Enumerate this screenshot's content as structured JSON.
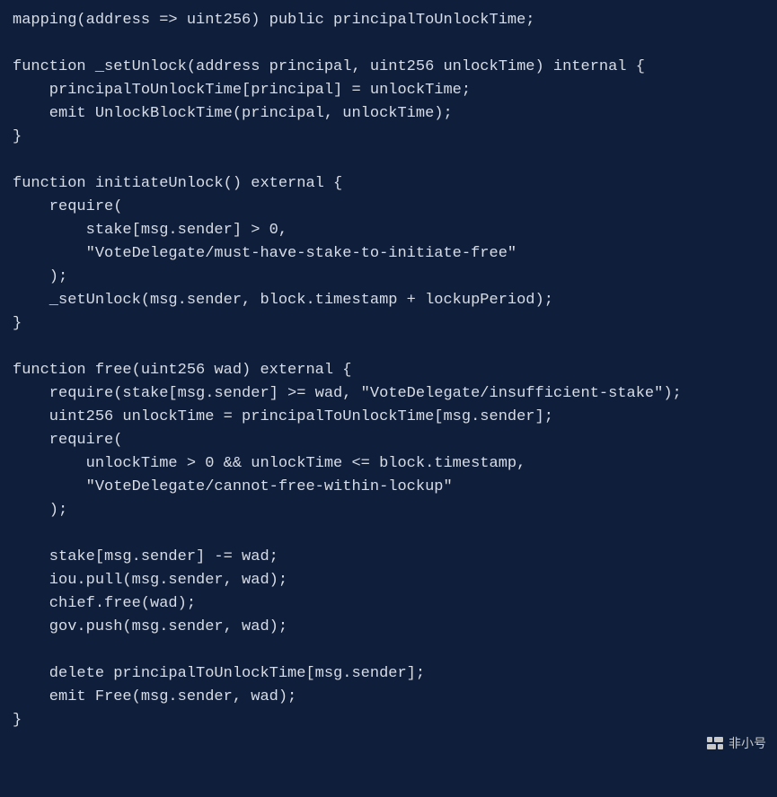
{
  "code": {
    "lines": [
      "mapping(address => uint256) public principalToUnlockTime;",
      "",
      "function _setUnlock(address principal, uint256 unlockTime) internal {",
      "    principalToUnlockTime[principal] = unlockTime;",
      "    emit UnlockBlockTime(principal, unlockTime);",
      "}",
      "",
      "function initiateUnlock() external {",
      "    require(",
      "        stake[msg.sender] > 0,",
      "        \"VoteDelegate/must-have-stake-to-initiate-free\"",
      "    );",
      "    _setUnlock(msg.sender, block.timestamp + lockupPeriod);",
      "}",
      "",
      "function free(uint256 wad) external {",
      "    require(stake[msg.sender] >= wad, \"VoteDelegate/insufficient-stake\");",
      "    uint256 unlockTime = principalToUnlockTime[msg.sender];",
      "    require(",
      "        unlockTime > 0 && unlockTime <= block.timestamp,",
      "        \"VoteDelegate/cannot-free-within-lockup\"",
      "    );",
      "",
      "    stake[msg.sender] -= wad;",
      "    iou.pull(msg.sender, wad);",
      "    chief.free(wad);",
      "    gov.push(msg.sender, wad);",
      "",
      "    delete principalToUnlockTime[msg.sender];",
      "    emit Free(msg.sender, wad);",
      "}"
    ]
  },
  "watermark": {
    "text": "非小号"
  }
}
